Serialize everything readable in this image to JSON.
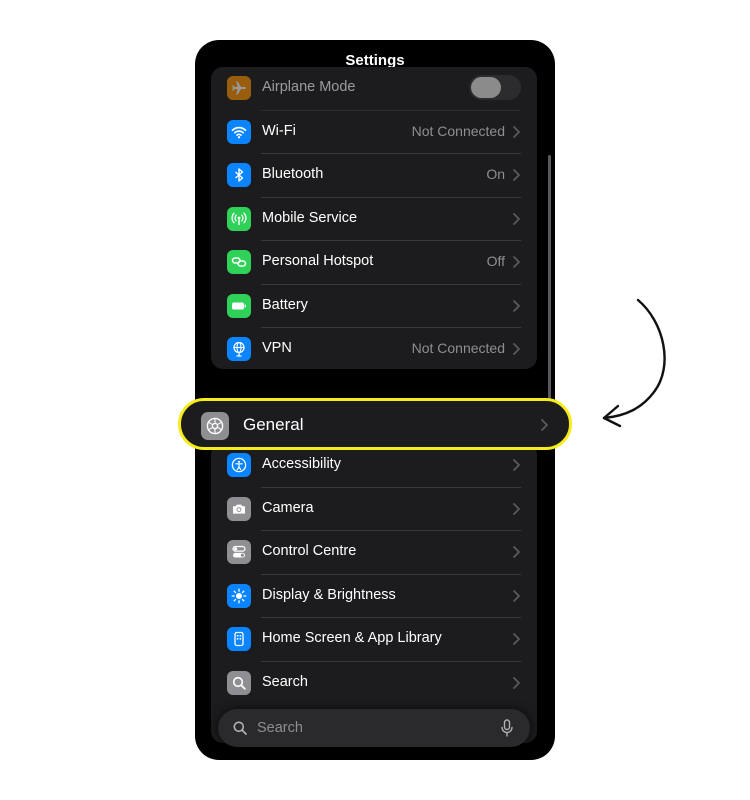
{
  "header": {
    "title": "Settings"
  },
  "connectivity": [
    {
      "label": "Airplane Mode",
      "icon": "airplane-icon",
      "color": "#ff9500",
      "toggle": false
    },
    {
      "label": "Wi-Fi",
      "value": "Not Connected",
      "icon": "wifi-icon",
      "color": "#0a84ff"
    },
    {
      "label": "Bluetooth",
      "value": "On",
      "icon": "bluetooth-icon",
      "color": "#0a84ff"
    },
    {
      "label": "Mobile Service",
      "value": "",
      "icon": "antenna-icon",
      "color": "#30d158"
    },
    {
      "label": "Personal Hotspot",
      "value": "Off",
      "icon": "hotspot-icon",
      "color": "#30d158"
    },
    {
      "label": "Battery",
      "value": "",
      "icon": "battery-icon",
      "color": "#30d158"
    },
    {
      "label": "VPN",
      "value": "Not Connected",
      "icon": "vpn-globe-icon",
      "color": "#0a84ff"
    }
  ],
  "highlight": {
    "label": "General",
    "icon": "gear-icon",
    "color": "#8e8e93",
    "outline_color": "#f5ec1a"
  },
  "system": [
    {
      "label": "Accessibility",
      "icon": "accessibility-icon",
      "color": "#0a84ff"
    },
    {
      "label": "Camera",
      "icon": "camera-icon",
      "color": "#8e8e93"
    },
    {
      "label": "Control Centre",
      "icon": "switches-icon",
      "color": "#8e8e93"
    },
    {
      "label": "Display & Brightness",
      "icon": "sun-icon",
      "color": "#0a84ff"
    },
    {
      "label": "Home Screen & App Library",
      "icon": "home-screen-icon",
      "color": "#0a84ff"
    },
    {
      "label": "Search",
      "icon": "search-icon",
      "color": "#8e8e93"
    }
  ],
  "search": {
    "placeholder": "Search"
  },
  "annotation": {
    "arrow_color": "#000000"
  }
}
